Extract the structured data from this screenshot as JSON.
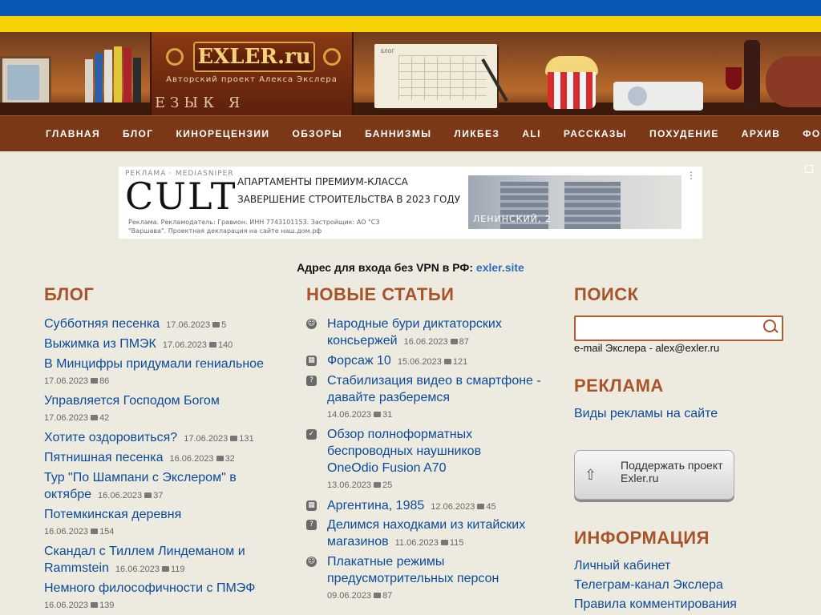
{
  "logo": {
    "title": "EXLER.ru",
    "subtitle": "Авторский проект Алекса Экслера",
    "tiles": "ЕЗЫК Я"
  },
  "nav": {
    "items": [
      "ГЛАВНАЯ",
      "БЛОГ",
      "КИНОРЕЦЕНЗИИ",
      "ОБЗОРЫ",
      "БАННИЗМЫ",
      "ЛИКБЕЗ",
      "ALI",
      "РАССКАЗЫ",
      "ПОХУДЕНИЕ",
      "АРХИВ",
      "ФОРУМ"
    ]
  },
  "ad": {
    "label": "РЕКЛАМА · MEDIASNIPER",
    "brand": "CULT",
    "line1": "АПАРТАМЕНТЫ ПРЕМИУМ-КЛАССА",
    "line2": "ЗАВЕРШЕНИЕ СТРОИТЕЛЬСТВА  В 2023 ГОДУ",
    "legal": "Реклама. Рекламодатель: Гравион. ИНН 7743101153. Застройщик: АО \"СЗ \"Варшава\". Проектная декларация на сайте наш.дом.рф",
    "caption": "ЛЕНИНСКИЙ, 2",
    "close": "⋮"
  },
  "vpn": {
    "text": "Адрес для входа без VPN в РФ: ",
    "link": "exler.site"
  },
  "blog": {
    "title": "БЛОГ",
    "posts": [
      {
        "title": "Субботняя песенка",
        "date": "17.06.2023",
        "comments": "5"
      },
      {
        "title": "Выжимка из ПМЭК",
        "date": "17.06.2023",
        "comments": "140"
      },
      {
        "title": "В Минцифры придумали гениальное",
        "date": "17.06.2023",
        "comments": "86"
      },
      {
        "title": "Управляется Господом Богом",
        "date": "17.06.2023",
        "comments": "42"
      },
      {
        "title": "Хотите оздоровиться?",
        "date": "17.06.2023",
        "comments": "131"
      },
      {
        "title": "Пятнишная песенка",
        "date": "16.06.2023",
        "comments": "32"
      },
      {
        "title": "Тур \"По Шампани с Экслером\" в октябре",
        "date": "16.06.2023",
        "comments": "37"
      },
      {
        "title": "Потемкинская деревня",
        "date": "16.06.2023",
        "comments": "154"
      },
      {
        "title": "Скандал с Тиллем Линдеманом и Rammstein",
        "date": "16.06.2023",
        "comments": "119"
      },
      {
        "title": "Немного философичности с ПМЭФ",
        "date": "16.06.2023",
        "comments": "139"
      }
    ]
  },
  "articles": {
    "title": "НОВЫЕ СТАТЬИ",
    "items": [
      {
        "icon": "smile-icon",
        "title": "Народные бури диктаторских консьержей",
        "date": "16.06.2023",
        "comments": "87"
      },
      {
        "icon": "clapper-icon",
        "title": "Форсаж 10",
        "date": "15.06.2023",
        "comments": "121"
      },
      {
        "icon": "question-icon",
        "title": "Стабилизация видео в смартфоне - давайте разберемся",
        "date": "14.06.2023",
        "comments": "31"
      },
      {
        "icon": "clipboard-icon",
        "title": "Обзор полноформатных беспроводных наушников OneOdio Fusion A70",
        "date": "13.06.2023",
        "comments": "25"
      },
      {
        "icon": "clapper-icon",
        "title": "Аргентина, 1985",
        "date": "12.06.2023",
        "comments": "45"
      },
      {
        "icon": "question-icon",
        "title": "Делимся находками из китайских магазинов",
        "date": "11.06.2023",
        "comments": "115"
      },
      {
        "icon": "smile-icon",
        "title": "Плакатные режимы предусмотрительных персон",
        "date": "09.06.2023",
        "comments": "87"
      }
    ]
  },
  "search": {
    "title": "ПОИСК",
    "value": "",
    "email": "e-mail Экслера - alex@exler.ru"
  },
  "advert": {
    "title": "РЕКЛАМА",
    "link": "Виды рекламы на сайте"
  },
  "support": {
    "label": "Поддержать проект Exler.ru"
  },
  "info": {
    "title": "ИНФОРМАЦИЯ",
    "links": [
      "Личный кабинет",
      "Телеграм-канал Экслера",
      "Правила комментирования"
    ]
  },
  "colors": {
    "accent": "#a9532a",
    "link": "#0b4a9a",
    "nav": "#7b3816",
    "flag_blue": "#0a57b6",
    "flag_yellow": "#f6d207"
  }
}
